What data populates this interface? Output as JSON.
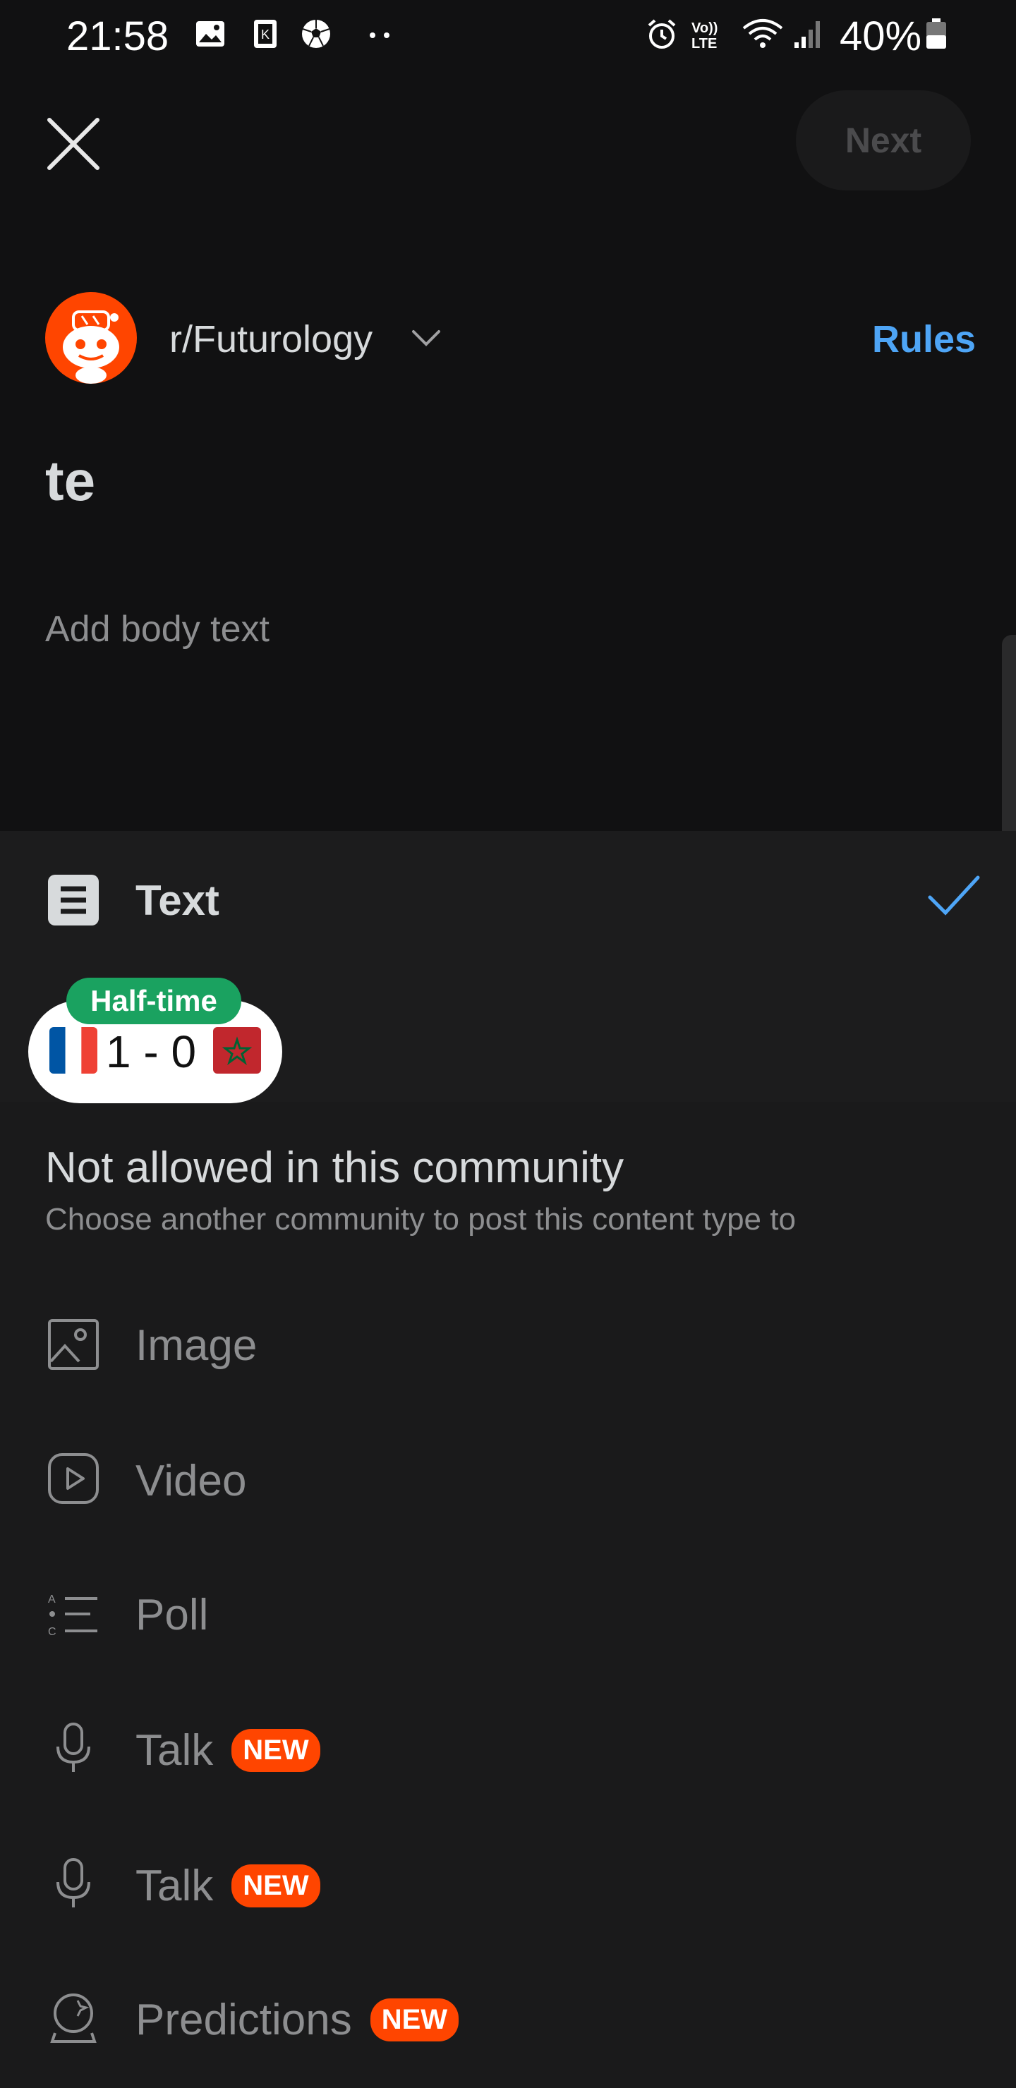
{
  "status_bar": {
    "time": "21:58",
    "battery": "40%",
    "icons": [
      "gallery-icon",
      "notification-k-icon",
      "soccer-icon",
      "more-dots-icon",
      "alarm-icon",
      "volte-icon",
      "wifi-icon",
      "signal-icon",
      "battery-icon"
    ]
  },
  "header": {
    "next_label": "Next"
  },
  "community": {
    "name": "r/Futurology",
    "rules_label": "Rules"
  },
  "post": {
    "title": "te",
    "body_placeholder": "Add body text"
  },
  "types": {
    "selected": {
      "label": "Text"
    },
    "notice_title": "Not allowed in this community",
    "notice_subtitle": "Choose another community to post this content type to",
    "options": [
      {
        "label": "Image",
        "icon": "image-icon",
        "badge": ""
      },
      {
        "label": "Video",
        "icon": "video-icon",
        "badge": ""
      },
      {
        "label": "Poll",
        "icon": "poll-icon",
        "badge": ""
      },
      {
        "label": "Talk",
        "icon": "microphone-icon",
        "badge": "NEW"
      },
      {
        "label": "Talk",
        "icon": "microphone-icon",
        "badge": "NEW"
      },
      {
        "label": "Predictions",
        "icon": "predictions-icon",
        "badge": "NEW"
      }
    ]
  },
  "score_widget": {
    "status": "Half-time",
    "score": "1 - 0",
    "home_flag": "france-flag-icon",
    "away_flag": "morocco-flag-icon"
  },
  "colors": {
    "accent_blue": "#4ea5f6",
    "reddit_orange": "#ff4500",
    "halftime_green": "#1aa260"
  }
}
